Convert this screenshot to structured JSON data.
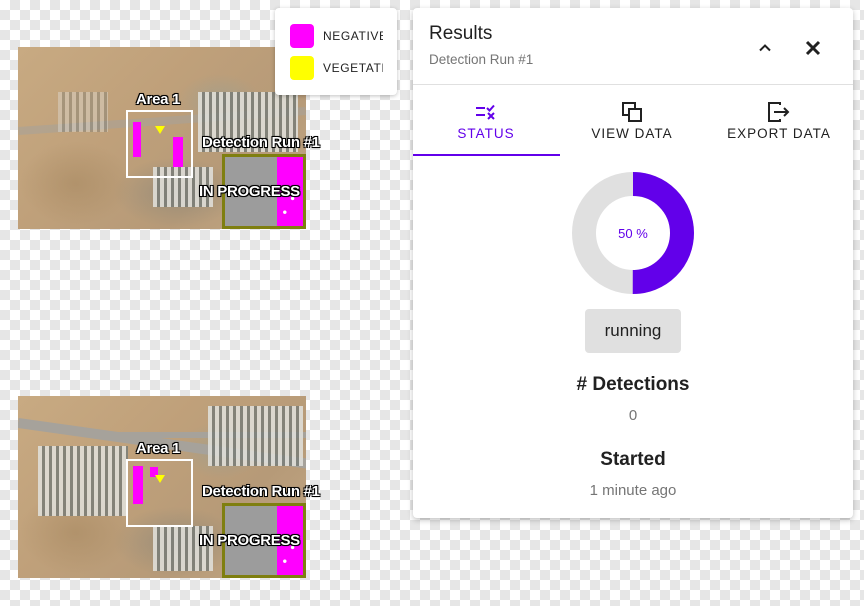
{
  "legend": {
    "items": [
      {
        "label": "NEGATIVE",
        "color": "#ff00ff"
      },
      {
        "label": "VEGETATI",
        "color": "#ffff00"
      }
    ]
  },
  "maps": [
    {
      "area_label": "Area 1",
      "run_label": "Detection Run #1",
      "status_label": "IN PROGRESS"
    },
    {
      "area_label": "Area 1",
      "run_label": "Detection Run #1",
      "status_label": "IN PROGRESS"
    }
  ],
  "panel": {
    "title": "Results",
    "subtitle": "Detection Run #1",
    "collapse_icon": "chevron-up-icon",
    "close_icon": "close-icon",
    "tabs": [
      {
        "label": "STATUS",
        "icon": "checklist-icon",
        "active": true
      },
      {
        "label": "VIEW DATA",
        "icon": "copy-icon",
        "active": false
      },
      {
        "label": "EXPORT DATA",
        "icon": "export-icon",
        "active": false
      }
    ],
    "progress": {
      "percent": 50,
      "label": "50 %",
      "color": "#6200ea",
      "track_color": "#e0e0e0"
    },
    "status_chip": "running",
    "detections": {
      "heading": "# Detections",
      "value": "0"
    },
    "started": {
      "heading": "Started",
      "value": "1 minute ago"
    }
  }
}
